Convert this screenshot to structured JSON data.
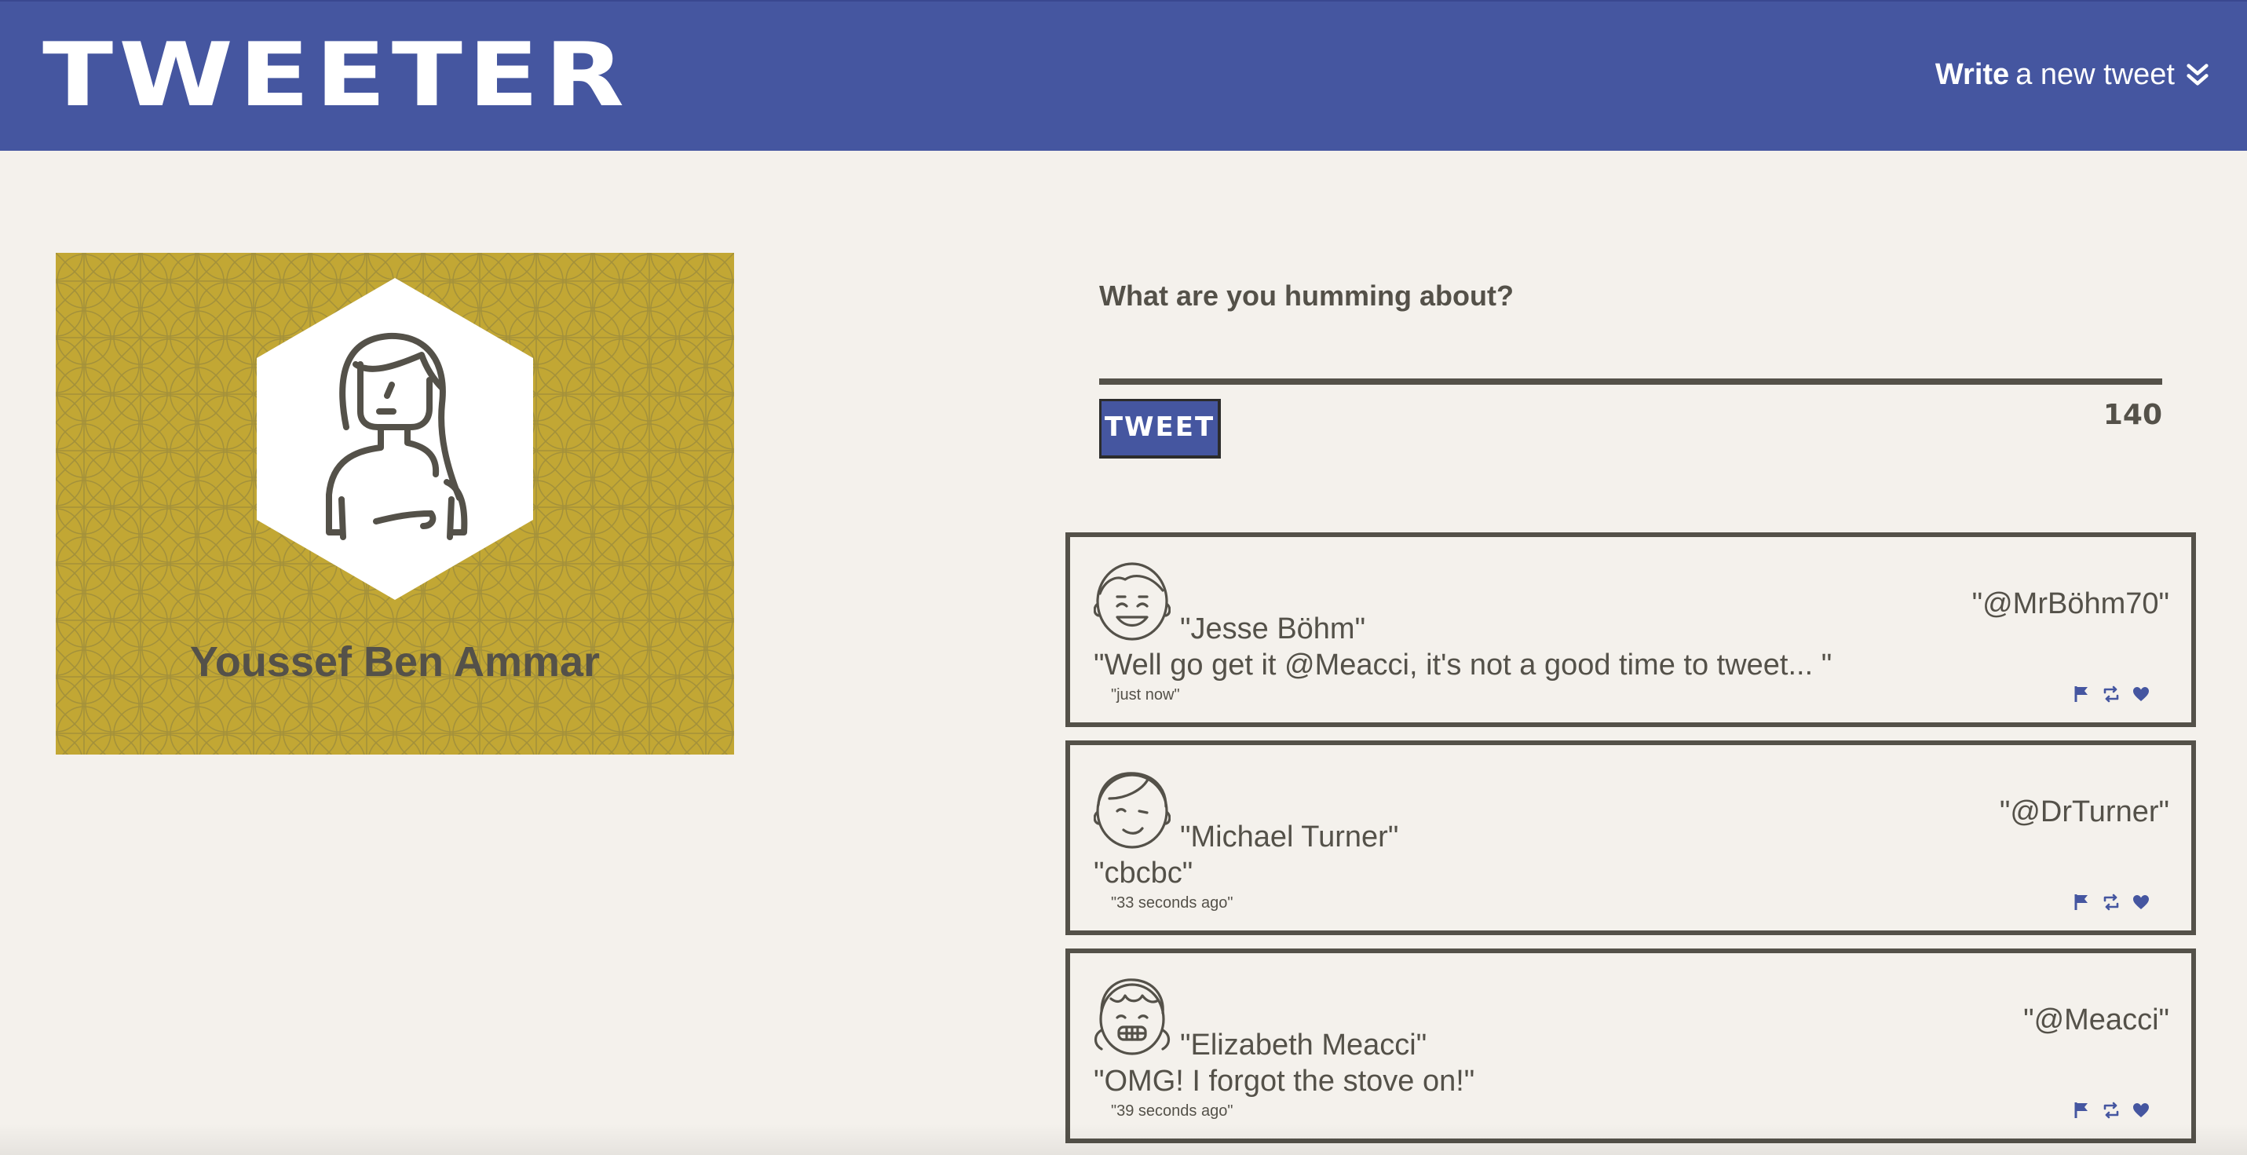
{
  "header": {
    "brand": "TWEETER",
    "compose_toggle_strong": "Write",
    "compose_toggle_rest": "a new tweet",
    "compose_icon": "double-chevron-down-icon"
  },
  "profile": {
    "name": "Youssef Ben Ammar",
    "avatar_icon": "woman-avatar-icon",
    "background_color": "#c2a734"
  },
  "composer": {
    "label": "What are you humming about?",
    "button_label": "TWEET",
    "counter": "140"
  },
  "tweets": [
    {
      "name": "\"Jesse Böhm\"",
      "handle": "\"@MrBöhm70\"",
      "content": "\"Well go get it @Meacci, it's not a good time to tweet... \"",
      "time": "\"just now\"",
      "avatar_icon": "smiling-man-avatar-icon"
    },
    {
      "name": "\"Michael Turner\"",
      "handle": "\"@DrTurner\"",
      "content": "\"cbcbc\"",
      "time": "\"33 seconds ago\"",
      "avatar_icon": "winking-man-avatar-icon"
    },
    {
      "name": "\"Elizabeth Meacci\"",
      "handle": "\"@Meacci\"",
      "content": "\"OMG! I forgot the stove on!\"",
      "time": "\"39 seconds ago\"",
      "avatar_icon": "grinning-girl-avatar-icon"
    }
  ],
  "actions": [
    "flag-icon",
    "retweet-icon",
    "heart-icon"
  ],
  "colors": {
    "nav": "#4556a0",
    "background": "#f4f1ec",
    "text": "#545149",
    "accent": "#4556a0"
  }
}
